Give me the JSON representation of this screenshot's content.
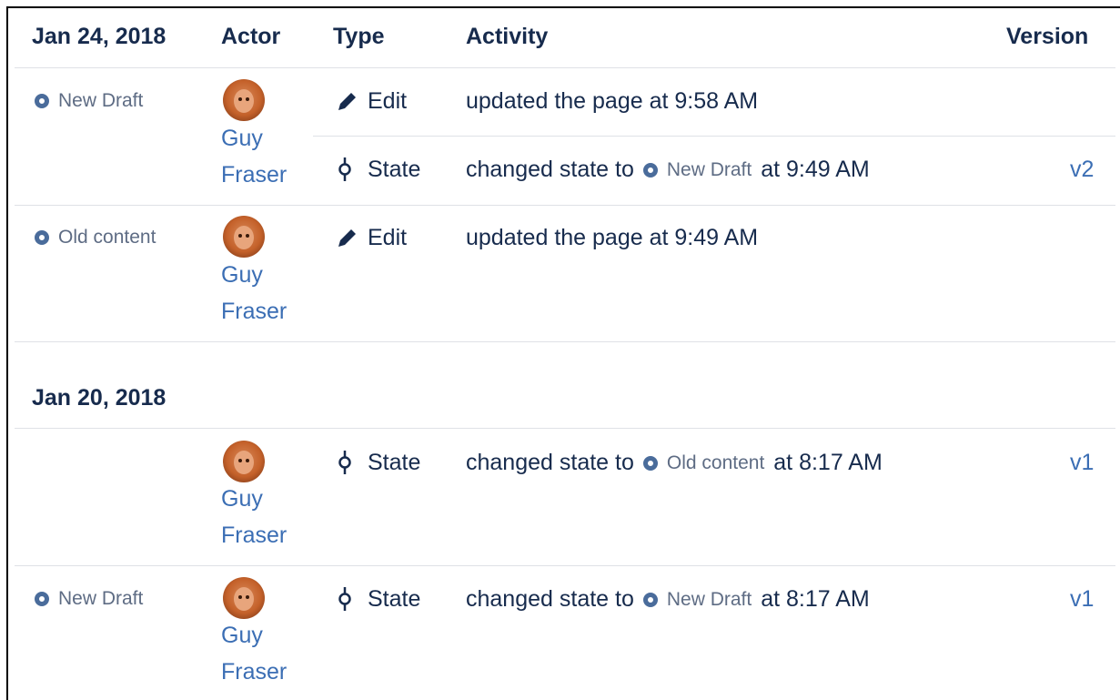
{
  "header": {
    "date": "Jan 24, 2018",
    "actor": "Actor",
    "type": "Type",
    "activity": "Activity",
    "version": "Version"
  },
  "groups": [
    {
      "date": "Jan 24, 2018",
      "rows": [
        {
          "state": "New Draft",
          "actor_first": "Guy",
          "actor_last": "Fraser",
          "entries": [
            {
              "type_icon": "pencil-icon",
              "type": "Edit",
              "activity_pre": "updated the page at 9:58 AM",
              "version": ""
            },
            {
              "type_icon": "commit-icon",
              "type": "State",
              "activity_pre": "changed state to",
              "activity_state": "New Draft",
              "activity_post": "at 9:49 AM",
              "version": "v2"
            }
          ]
        },
        {
          "state": "Old content",
          "actor_first": "Guy",
          "actor_last": "Fraser",
          "entries": [
            {
              "type_icon": "pencil-icon",
              "type": "Edit",
              "activity_pre": "updated the page at 9:49 AM",
              "version": ""
            }
          ]
        }
      ]
    },
    {
      "date": "Jan 20, 2018",
      "rows": [
        {
          "state": "",
          "actor_first": "Guy",
          "actor_last": "Fraser",
          "entries": [
            {
              "type_icon": "commit-icon",
              "type": "State",
              "activity_pre": "changed state to",
              "activity_state": "Old content",
              "activity_post": "at 8:17 AM",
              "version": "v1"
            }
          ]
        },
        {
          "state": "New Draft",
          "actor_first": "Guy",
          "actor_last": "Fraser",
          "entries": [
            {
              "type_icon": "commit-icon",
              "type": "State",
              "activity_pre": "changed state to",
              "activity_state": "New Draft",
              "activity_post": "at 8:17 AM",
              "version": "v1"
            }
          ]
        }
      ]
    }
  ],
  "colors": {
    "link": "#3b6eb4",
    "text": "#172b4d",
    "lozenge_dot": "#4a6c9b",
    "lozenge_text": "#5e6c84",
    "divider": "#dfe1e6"
  }
}
